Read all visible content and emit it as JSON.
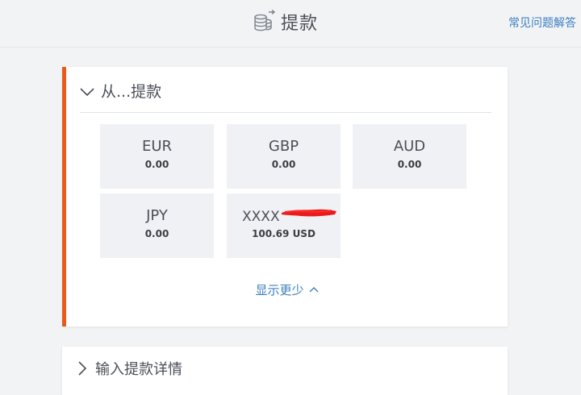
{
  "header": {
    "title": "提款",
    "icon": "coins-icon",
    "faq_label": "常见问题解答"
  },
  "source_card": {
    "title": "从...提款",
    "accent_color": "#e8591c",
    "accounts": [
      {
        "currency": "EUR",
        "amount": "0.00"
      },
      {
        "currency": "GBP",
        "amount": "0.00"
      },
      {
        "currency": "AUD",
        "amount": "0.00"
      },
      {
        "currency": "JPY",
        "amount": "0.00"
      },
      {
        "name": "XXXX",
        "amount": "100.69 USD"
      }
    ],
    "show_less_label": "显示更少"
  },
  "details_card": {
    "title": "输入提款详情"
  }
}
